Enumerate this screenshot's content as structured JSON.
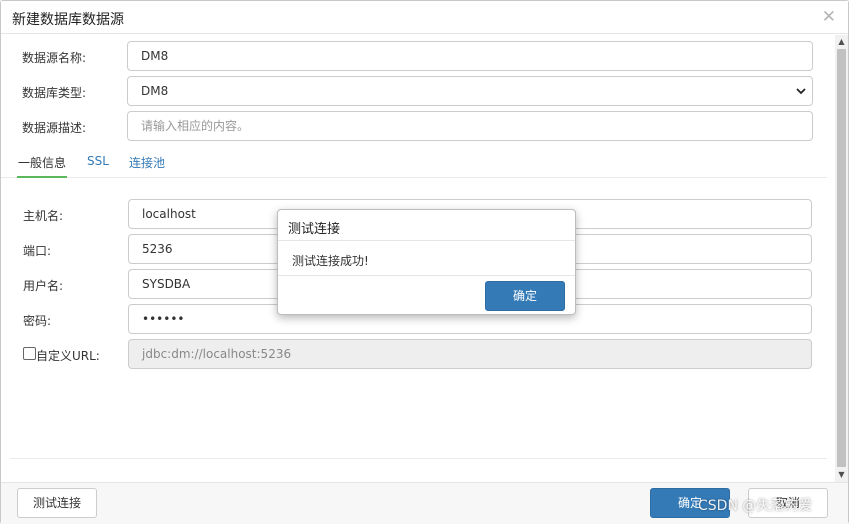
{
  "window": {
    "title": "新建数据库数据源"
  },
  "form": {
    "name_label": "数据源名称:",
    "name_value": "DM8",
    "type_label": "数据库类型:",
    "type_value": "DM8",
    "desc_label": "数据源描述:",
    "desc_placeholder": "请输入相应的内容。"
  },
  "tabs": [
    {
      "label": "一般信息",
      "active": true
    },
    {
      "label": "SSL",
      "active": false
    },
    {
      "label": "连接池",
      "active": false
    }
  ],
  "general": {
    "host_label": "主机名:",
    "host_value": "localhost",
    "port_label": "端口:",
    "port_value": "5236",
    "user_label": "用户名:",
    "user_value": "SYSDBA",
    "password_label": "密码:",
    "password_value": "••••••",
    "custom_url_label": "自定义URL:",
    "url_value": "jdbc:dm://localhost:5236"
  },
  "footer": {
    "test_label": "测试连接",
    "ok_label": "确定",
    "cancel_label": "取消"
  },
  "modal": {
    "title": "测试连接",
    "message": "测试连接成功!",
    "ok_label": "确定"
  },
  "watermark": "CSDN @失落的爱",
  "colors": {
    "primary": "#337ab7",
    "tab_active_underline": "#5cb85c",
    "link": "#337ab7"
  },
  "icons": {
    "close": "close-icon",
    "select_arrow": "chevron-down-icon",
    "scroll_up": "scroll-up-icon",
    "scroll_down": "scroll-down-icon"
  }
}
